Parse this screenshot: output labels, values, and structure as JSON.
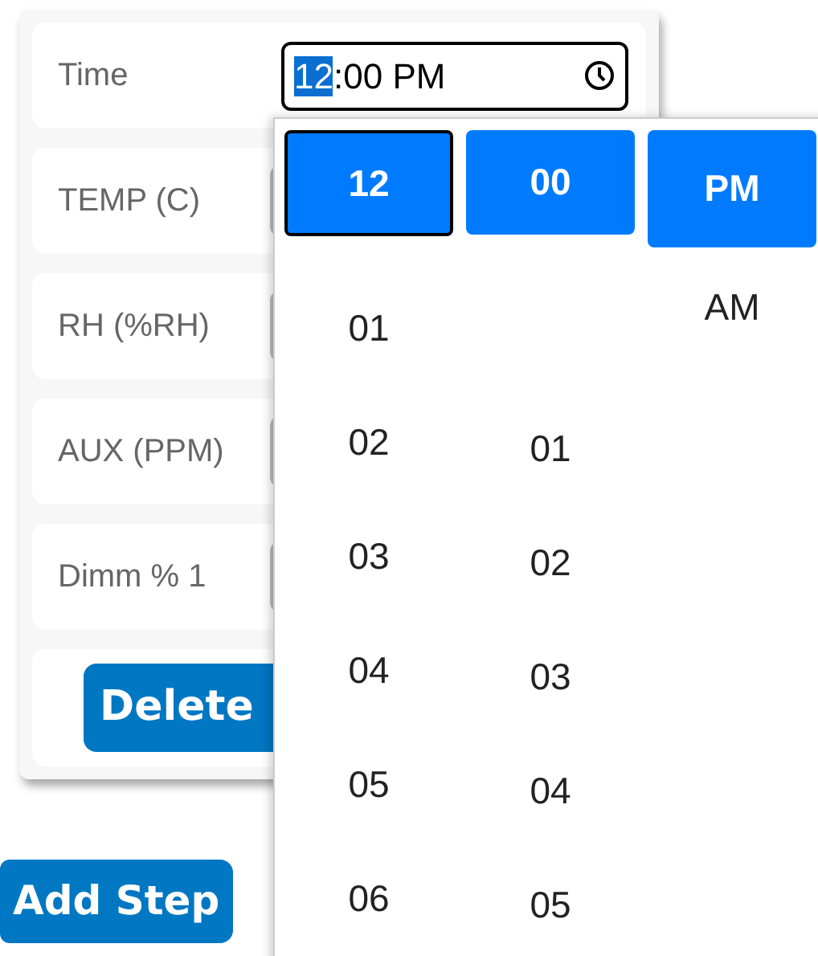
{
  "form": {
    "rows": [
      {
        "label": "Time",
        "kind": "time"
      },
      {
        "label": "TEMP (C)",
        "kind": "input"
      },
      {
        "label": "RH (%RH)",
        "kind": "input"
      },
      {
        "label": "AUX (PPM)",
        "kind": "input"
      },
      {
        "label": "Dimm % 1",
        "kind": "input"
      }
    ],
    "time_field": {
      "segments": [
        {
          "text": "12",
          "selected": true
        },
        {
          "text": ":",
          "selected": false
        },
        {
          "text": "00",
          "selected": false
        },
        {
          "text": " PM",
          "selected": false
        }
      ]
    },
    "delete_button": "Delete"
  },
  "add_step_button": "Add Step",
  "time_picker": {
    "columns": [
      {
        "kind": "hour",
        "items": [
          {
            "label": "12",
            "selected": true,
            "focused": true
          },
          {
            "label": "01",
            "selected": false,
            "focused": false
          },
          {
            "label": "02",
            "selected": false,
            "focused": false
          },
          {
            "label": "03",
            "selected": false,
            "focused": false
          },
          {
            "label": "04",
            "selected": false,
            "focused": false
          },
          {
            "label": "05",
            "selected": false,
            "focused": false
          },
          {
            "label": "06",
            "selected": false,
            "focused": false
          }
        ]
      },
      {
        "kind": "minute",
        "items": [
          {
            "label": "00",
            "selected": true,
            "focused": false
          },
          {
            "label": "01",
            "selected": false,
            "focused": false
          },
          {
            "label": "02",
            "selected": false,
            "focused": false
          },
          {
            "label": "03",
            "selected": false,
            "focused": false
          },
          {
            "label": "04",
            "selected": false,
            "focused": false
          },
          {
            "label": "05",
            "selected": false,
            "focused": false
          }
        ]
      },
      {
        "kind": "period",
        "items": [
          {
            "label": "PM",
            "selected": true,
            "focused": false
          },
          {
            "label": "AM",
            "selected": false,
            "focused": false
          }
        ]
      }
    ]
  }
}
